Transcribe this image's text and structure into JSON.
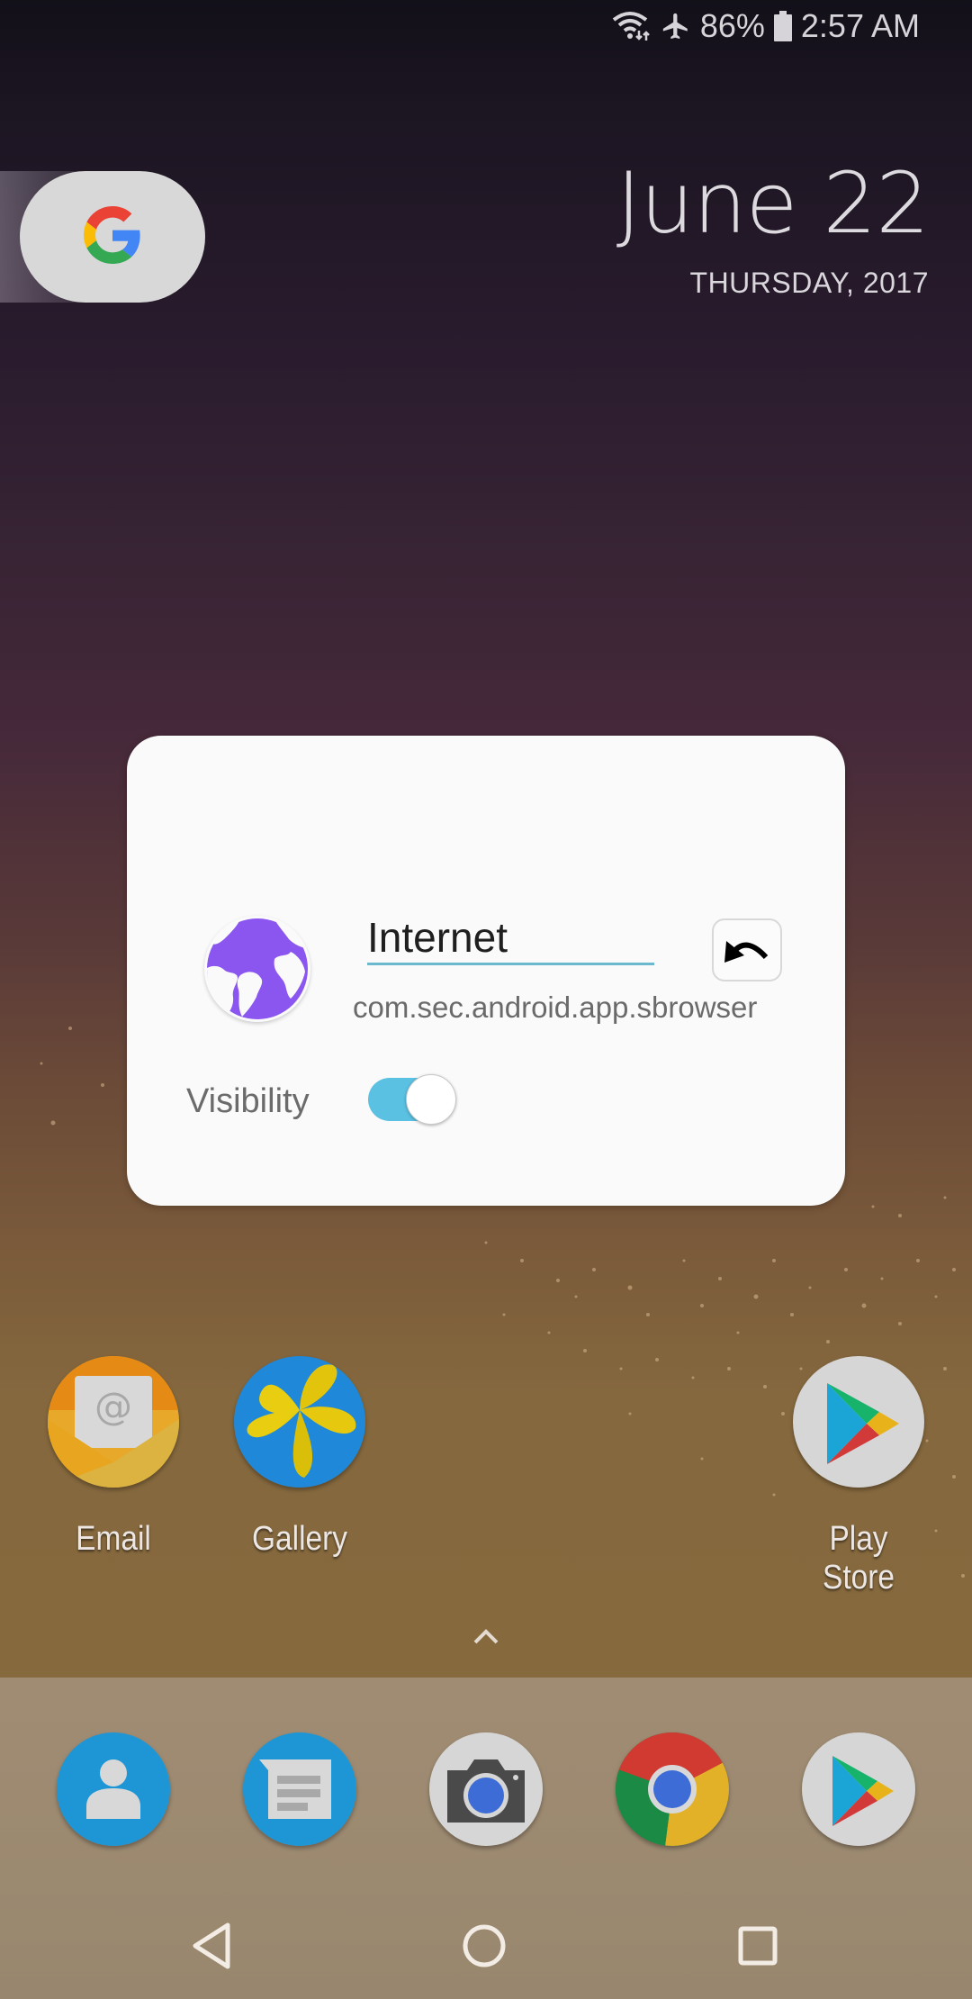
{
  "status_bar": {
    "wifi_icon": "wifi-data-icon",
    "airplane_icon": "airplane-icon",
    "battery_percent": "86%",
    "battery_icon": "battery-icon",
    "time": "2:57 AM"
  },
  "google_widget": {
    "icon": "google-g-icon"
  },
  "date_widget": {
    "date": "June 22",
    "weekday_year": "THURSDAY, 2017"
  },
  "edit_dialog": {
    "app_icon": "internet-globe-icon",
    "app_name_value": "Internet",
    "undo_icon": "undo-icon",
    "package_name": "com.sec.android.app.sbrowser",
    "visibility_label": "Visibility",
    "visibility_enabled": true,
    "accent_color": "#5ac1e2"
  },
  "home_apps": [
    {
      "label": "Email",
      "icon": "email-icon"
    },
    {
      "label": "Gallery",
      "icon": "gallery-icon"
    },
    {
      "label": "Play Store",
      "icon": "play-store-icon"
    }
  ],
  "app_drawer": {
    "icon": "chevron-up-icon"
  },
  "dock_apps": [
    {
      "name": "Contacts",
      "icon": "contacts-icon"
    },
    {
      "name": "Messages",
      "icon": "messages-icon"
    },
    {
      "name": "Camera",
      "icon": "camera-icon"
    },
    {
      "name": "Chrome",
      "icon": "chrome-icon"
    },
    {
      "name": "Play Store",
      "icon": "play-store-icon"
    }
  ],
  "nav_bar": {
    "back": "back-icon",
    "home": "home-icon",
    "recents": "recents-icon"
  }
}
